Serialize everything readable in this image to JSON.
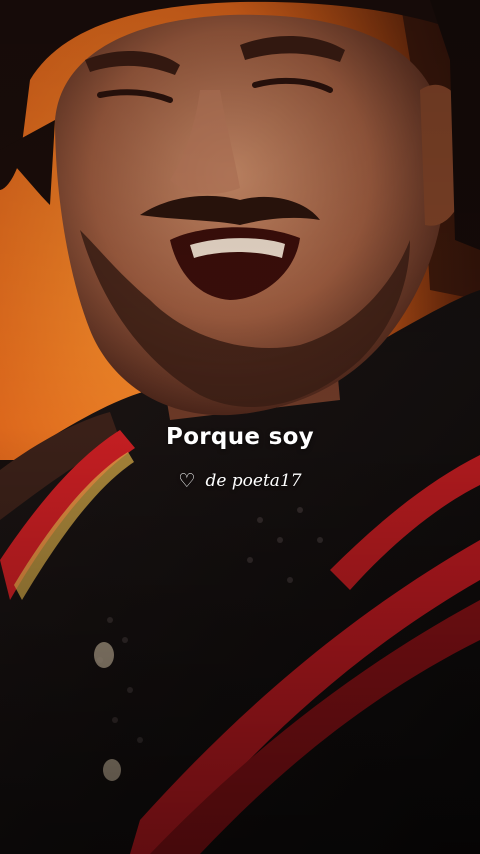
{
  "video": {
    "lyric": "Porque soy",
    "credit_icon": "heart-outline-icon",
    "credit_icon_glyph": "♡",
    "credit": "de poeta17"
  },
  "colors": {
    "backdrop_orange": "#e8721c",
    "shadow": "#0c0a0a",
    "skin": "#b0704f",
    "jacket_red": "#b0181e",
    "text": "#ffffff"
  }
}
